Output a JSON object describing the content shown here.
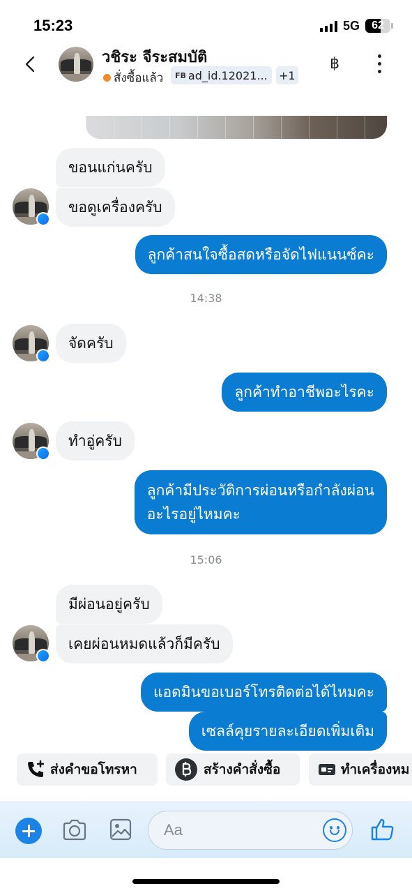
{
  "status_bar": {
    "time": "15:23",
    "network": "5G",
    "battery": "62",
    "battery_level": 0.62
  },
  "header": {
    "contact_name": "วชิระ จีระสมบัติ",
    "order_status": "สั่งซื้อแล้ว",
    "tag_prefix": "FB",
    "tag_label": "ad_id.12021...",
    "tag_more": "+1",
    "currency_symbol": "฿"
  },
  "messages": [
    {
      "id": "m1",
      "side": "in",
      "text": "ขอนแก่นครับ"
    },
    {
      "id": "m2",
      "side": "in",
      "text": "ขอดูเครื่องครับ"
    },
    {
      "id": "m3",
      "side": "out",
      "text": "ลูกค้าสนใจซื้อสดหรือจัดไฟแนนซ์คะ"
    },
    {
      "id": "t1",
      "type": "timestamp",
      "text": "14:38"
    },
    {
      "id": "m4",
      "side": "in",
      "text": "จัดครับ"
    },
    {
      "id": "m5",
      "side": "out",
      "text": "ลูกค้าทำอาชีพอะไรคะ"
    },
    {
      "id": "m6",
      "side": "in",
      "text": "ทำอู่ครับ"
    },
    {
      "id": "m7",
      "side": "out",
      "line1": "ลูกค้ามีประวัติการผ่อนหรือกำลังผ่อน",
      "line2": "อะไรอยู่ไหมคะ"
    },
    {
      "id": "t2",
      "type": "timestamp",
      "text": "15:06"
    },
    {
      "id": "m8",
      "side": "in",
      "text": "มีผ่อนอยู่ครับ"
    },
    {
      "id": "m9",
      "side": "in",
      "text": "เคยผ่อนหมดแล้วก็มีครับ"
    },
    {
      "id": "m10",
      "side": "out",
      "text": "แอดมินขอเบอร์โทรติดต่อได้ไหมคะ"
    },
    {
      "id": "m11",
      "side": "out",
      "text": "เซลล์คุยรายละเอียดเพิ่มเติม"
    }
  ],
  "quick_actions": [
    {
      "label": "ส่งคำขอโทรหา",
      "icon": "phone-plus-icon"
    },
    {
      "label": "สร้างคำสั่งซื้อ",
      "icon": "bitcoin-baht-icon"
    },
    {
      "label": "ทำเครื่องหม",
      "icon": "id-card-icon"
    }
  ],
  "composer": {
    "placeholder": "Aa"
  },
  "colors": {
    "accent": "#0a7cd2",
    "incoming_bubble": "#f1f2f4",
    "order_dot": "#f58a2a"
  }
}
